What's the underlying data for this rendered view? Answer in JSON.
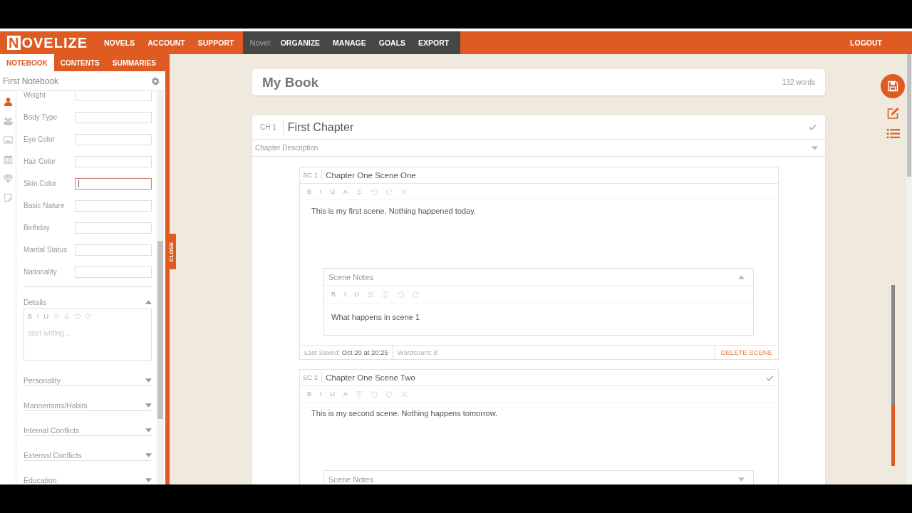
{
  "header": {
    "logo": "NOVELIZE",
    "nav": [
      "NOVELS",
      "ACCOUNT",
      "SUPPORT"
    ],
    "novel_label": "Novel:",
    "novel_nav": [
      "ORGANIZE",
      "MANAGE",
      "GOALS",
      "EXPORT"
    ],
    "logout": "LOGOUT"
  },
  "left_panel": {
    "tabs": [
      {
        "label": "NOTEBOOK",
        "selected": true
      },
      {
        "label": "CONTENTS",
        "selected": false
      },
      {
        "label": "SUMMARIES",
        "selected": false
      }
    ],
    "notebook_title": "First Notebook",
    "icons": [
      {
        "kind": "person",
        "selected": true
      },
      {
        "kind": "group",
        "selected": false
      },
      {
        "kind": "image",
        "selected": false
      },
      {
        "kind": "calendar",
        "selected": false
      },
      {
        "kind": "gem",
        "selected": false
      },
      {
        "kind": "note",
        "selected": false
      }
    ],
    "fields": [
      {
        "label": "Weight",
        "focused": false
      },
      {
        "label": "Body Type",
        "focused": false
      },
      {
        "label": "Eye Color",
        "focused": false
      },
      {
        "label": "Hair Color",
        "focused": false
      },
      {
        "label": "Skin Color",
        "focused": true
      },
      {
        "label": "Basic Nature",
        "focused": false
      },
      {
        "label": "Birthday",
        "focused": false
      },
      {
        "label": "Marital Status",
        "focused": false
      },
      {
        "label": "Nationality",
        "focused": false
      }
    ],
    "details": {
      "label": "Details",
      "expanded": true,
      "placeholder": "start writing...",
      "toolbar": [
        {
          "kind": "letter",
          "label": "B"
        },
        {
          "kind": "letter",
          "label": "I"
        },
        {
          "kind": "letter",
          "label": "U"
        },
        {
          "kind": "list"
        },
        {
          "kind": "align"
        },
        {
          "kind": "undo"
        },
        {
          "kind": "redo"
        }
      ]
    },
    "sections": [
      {
        "label": "Personality",
        "expanded": false
      },
      {
        "label": "Mannerisms/Habits",
        "expanded": false
      },
      {
        "label": "Internal Conflicts",
        "expanded": false
      },
      {
        "label": "External Conflicts",
        "expanded": false
      },
      {
        "label": "Education",
        "expanded": false
      }
    ],
    "close": "CLOSE"
  },
  "book": {
    "title": "My Book",
    "word_count": "132 words"
  },
  "chapter": {
    "number": "CH 1",
    "title": "First Chapter",
    "done": true,
    "description": {
      "placeholder": "Chapter Description",
      "expanded": false
    },
    "scenes": [
      {
        "number": "SC 1",
        "title": "Chapter One Scene One",
        "done": false,
        "toolbar": [
          {
            "kind": "letter",
            "label": "B"
          },
          {
            "kind": "letter",
            "label": "I"
          },
          {
            "kind": "letter",
            "label": "U"
          },
          {
            "kind": "letter",
            "label": "A"
          },
          {
            "kind": "align"
          },
          {
            "kind": "undo"
          },
          {
            "kind": "redo"
          },
          {
            "kind": "expand"
          }
        ],
        "text": "This is my first scene. Nothing happened today.",
        "notes": {
          "title": "Scene Notes",
          "expanded": true,
          "toolbar": [
            {
              "kind": "letter",
              "label": "B"
            },
            {
              "kind": "letter",
              "label": "I"
            },
            {
              "kind": "letter",
              "label": "U"
            },
            {
              "kind": "list"
            },
            {
              "kind": "align"
            },
            {
              "kind": "undo"
            },
            {
              "kind": "redo"
            }
          ],
          "text": "What happens in scene 1"
        },
        "footer": {
          "last_saved_label": "Last Saved:",
          "last_saved": "Oct 20 at 20:25",
          "wordcount": "Wordcount: 8",
          "delete": "DELETE SCENE"
        }
      },
      {
        "number": "SC 2",
        "title": "Chapter One Scene Two",
        "done": true,
        "toolbar": [
          {
            "kind": "letter",
            "label": "B"
          },
          {
            "kind": "letter",
            "label": "I"
          },
          {
            "kind": "letter",
            "label": "U"
          },
          {
            "kind": "letter",
            "label": "A"
          },
          {
            "kind": "align"
          },
          {
            "kind": "undo"
          },
          {
            "kind": "redo"
          },
          {
            "kind": "expand"
          }
        ],
        "text": "This is my second scene. Nothing happens tomorrow.",
        "notes": {
          "title": "Scene Notes",
          "expanded": false
        }
      }
    ]
  },
  "right_tools": [
    {
      "kind": "save"
    },
    {
      "kind": "edit"
    },
    {
      "kind": "list"
    }
  ],
  "progress": {
    "level": 0.34
  }
}
